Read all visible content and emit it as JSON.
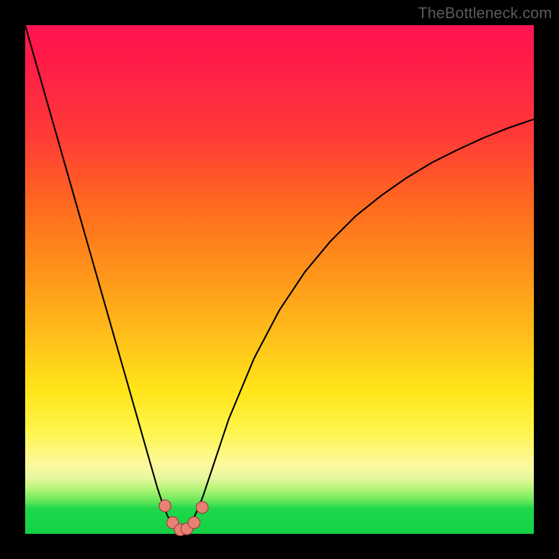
{
  "watermark": "TheBottleneck.com",
  "colors": {
    "frame": "#000000",
    "curve": "#000000",
    "point_fill": "#e88174",
    "point_stroke": "#a04038",
    "gradient": [
      "#ff1452",
      "#ff3b36",
      "#ff981a",
      "#ffe61a",
      "#fdf99a",
      "#68e85a",
      "#12d246"
    ]
  },
  "chart_data": {
    "type": "line",
    "title": "",
    "xlabel": "",
    "ylabel": "",
    "xlim": [
      0,
      100
    ],
    "ylim": [
      0,
      100
    ],
    "x": [
      0,
      1,
      2,
      3,
      4,
      5,
      6,
      7,
      8,
      9,
      10,
      11,
      12,
      13,
      14,
      15,
      16,
      17,
      18,
      19,
      20,
      21,
      22,
      23,
      24,
      25,
      26,
      27,
      28,
      29,
      30,
      31,
      32,
      33,
      34,
      35,
      36,
      37,
      38,
      39,
      40,
      45,
      50,
      55,
      60,
      65,
      70,
      75,
      80,
      85,
      90,
      95,
      100
    ],
    "y": [
      100,
      96.5,
      93,
      89.5,
      86,
      82.5,
      79,
      75.5,
      72,
      68.5,
      65,
      61.5,
      58,
      54.5,
      51,
      47.5,
      44,
      40.5,
      37,
      33.5,
      30,
      26.5,
      23,
      19.5,
      16,
      12.5,
      9,
      6,
      3.5,
      1.8,
      0.8,
      0.5,
      1.2,
      2.8,
      5,
      7.5,
      10.5,
      13.5,
      16.5,
      19.5,
      22.5,
      34.5,
      44,
      51.5,
      57.5,
      62.5,
      66.5,
      70,
      73,
      75.5,
      77.8,
      79.8,
      81.5
    ],
    "points": [
      {
        "x": 27.5,
        "y": 5.5
      },
      {
        "x": 29.0,
        "y": 2.2
      },
      {
        "x": 30.5,
        "y": 0.8
      },
      {
        "x": 31.8,
        "y": 1.0
      },
      {
        "x": 33.2,
        "y": 2.2
      },
      {
        "x": 34.8,
        "y": 5.2
      }
    ],
    "annotations": []
  }
}
